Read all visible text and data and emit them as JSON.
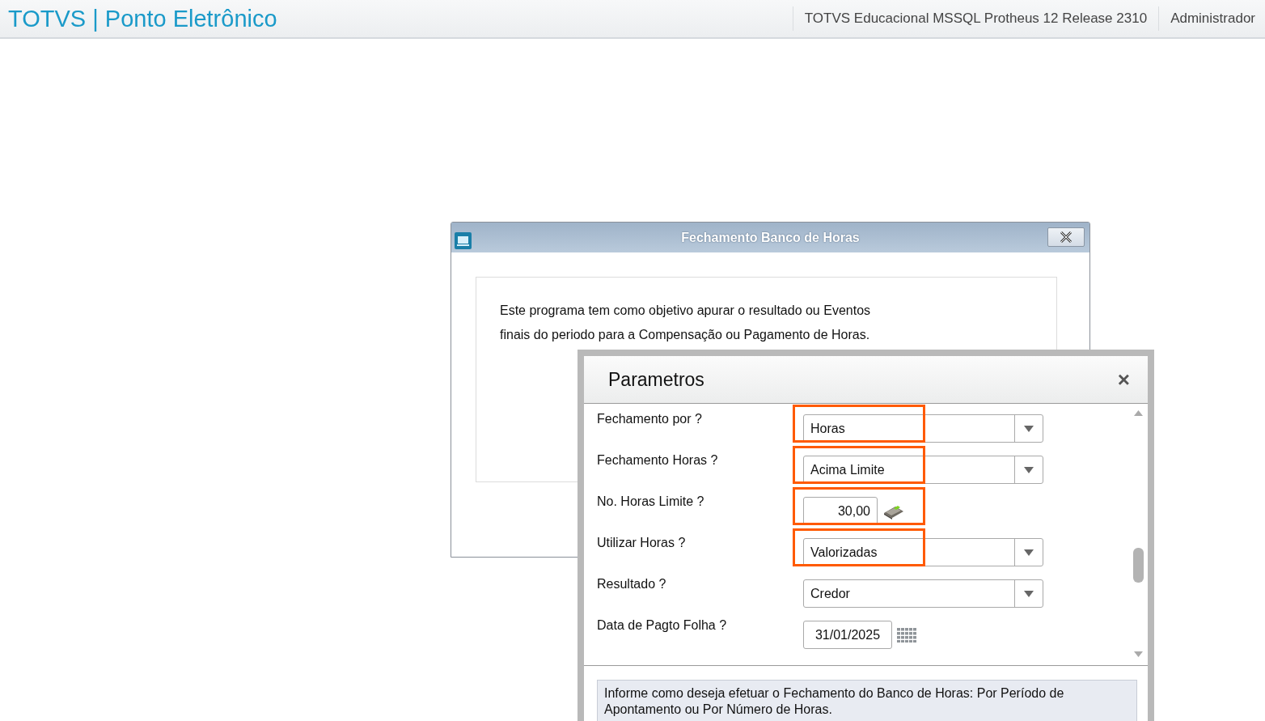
{
  "header": {
    "title": "TOTVS | Ponto Eletrônico",
    "environment": "TOTVS Educacional MSSQL Protheus 12 Release 2310",
    "user": "Administrador"
  },
  "main_dialog": {
    "title": "Fechamento Banco de Horas",
    "description_lines": [
      "Este programa tem como objetivo apurar o resultado ou Eventos",
      "finais do periodo para a Compensação ou Pagamento de Horas."
    ]
  },
  "parameters_dialog": {
    "title": "Parametros",
    "close": "×",
    "fields": [
      {
        "label": "Fechamento por ?",
        "kind": "combo",
        "value": "Horas",
        "highlighted": true
      },
      {
        "label": "Fechamento Horas ?",
        "kind": "combo",
        "value": "Acima Limite",
        "highlighted": true
      },
      {
        "label": "No. Horas Limite ?",
        "kind": "number",
        "value": "30,00",
        "highlighted": true
      },
      {
        "label": "Utilizar Horas ?",
        "kind": "combo",
        "value": "Valorizadas",
        "highlighted": true
      },
      {
        "label": "Resultado ?",
        "kind": "combo",
        "value": "Credor",
        "highlighted": false
      },
      {
        "label": "Data de Pagto Folha ?",
        "kind": "date",
        "value": "31/01/2025",
        "highlighted": false
      }
    ],
    "help_text": "Informe como deseja efetuar o Fechamento do Banco de Horas: Por Período de Apontamento ou Por Número de Horas."
  }
}
